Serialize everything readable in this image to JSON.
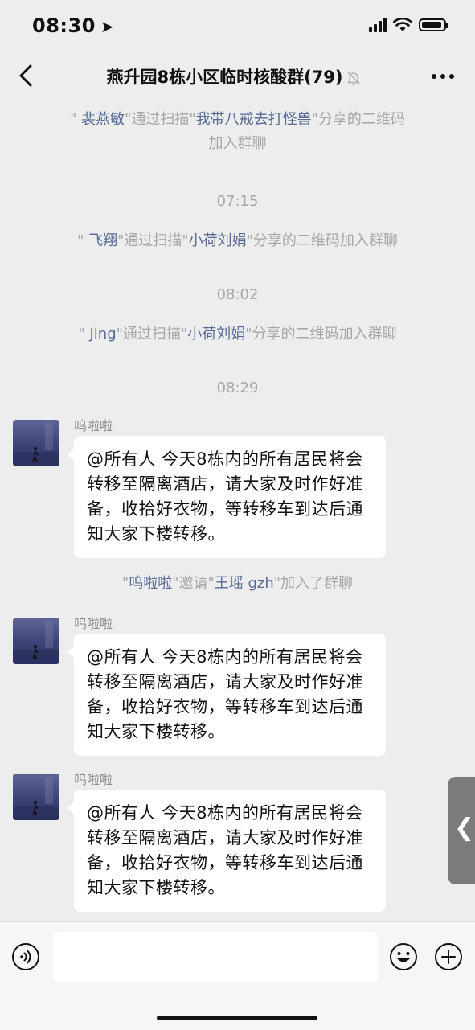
{
  "status": {
    "time": "08:30",
    "location_arrow": "➤"
  },
  "nav": {
    "title": "燕升园8栋小区临时核酸群(79)"
  },
  "chat": {
    "system_1": {
      "q1": "\" ",
      "n1": "裴燕敏",
      "mid": "\"通过扫描\"",
      "n2": "我带八戒去打怪兽",
      "tail": "\"分享的二维码",
      "line2": "加入群聊"
    },
    "time_1": "07:15",
    "system_2": {
      "q1": "\" ",
      "n1": "飞翔",
      "mid": "\"通过扫描\"",
      "n2": "小荷刘娟",
      "tail": "\"分享的二维码加入群聊"
    },
    "time_2": "08:02",
    "system_3": {
      "q1": "\" ",
      "n1": "Jing",
      "mid": "\"通过扫描\"",
      "n2": "小荷刘娟",
      "tail": "\"分享的二维码加入群聊"
    },
    "time_3": "08:29",
    "messages": [
      {
        "sender": "呜啦啦",
        "text": "@所有人 今天8栋内的所有居民将会转移至隔离酒店，请大家及时作好准备，收拾好衣物，等转移车到达后通知大家下楼转移。"
      },
      {
        "sender": "呜啦啦",
        "text": "@所有人 今天8栋内的所有居民将会转移至隔离酒店，请大家及时作好准备，收拾好衣物，等转移车到达后通知大家下楼转移。"
      },
      {
        "sender": "呜啦啦",
        "text": "@所有人 今天8栋内的所有居民将会转移至隔离酒店，请大家及时作好准备，收拾好衣物，等转移车到达后通知大家下楼转移。"
      }
    ],
    "invite": {
      "q1": "\"",
      "n1": "呜啦啦",
      "mid": "\"邀请\"",
      "n2": "王瑶 gzh",
      "tail": "\"加入了群聊"
    }
  },
  "side_handle": {
    "label": "❮"
  },
  "input": {
    "value": "",
    "placeholder": ""
  },
  "colors": {
    "link_name": "#576b95",
    "system_text": "#a6a6a6",
    "background": "#ededed"
  },
  "icons": [
    "location-arrow-icon",
    "signal-icon",
    "wifi-icon",
    "battery-icon",
    "back-icon",
    "mute-icon",
    "more-icon",
    "voice-icon",
    "emoji-icon",
    "plus-icon"
  ]
}
